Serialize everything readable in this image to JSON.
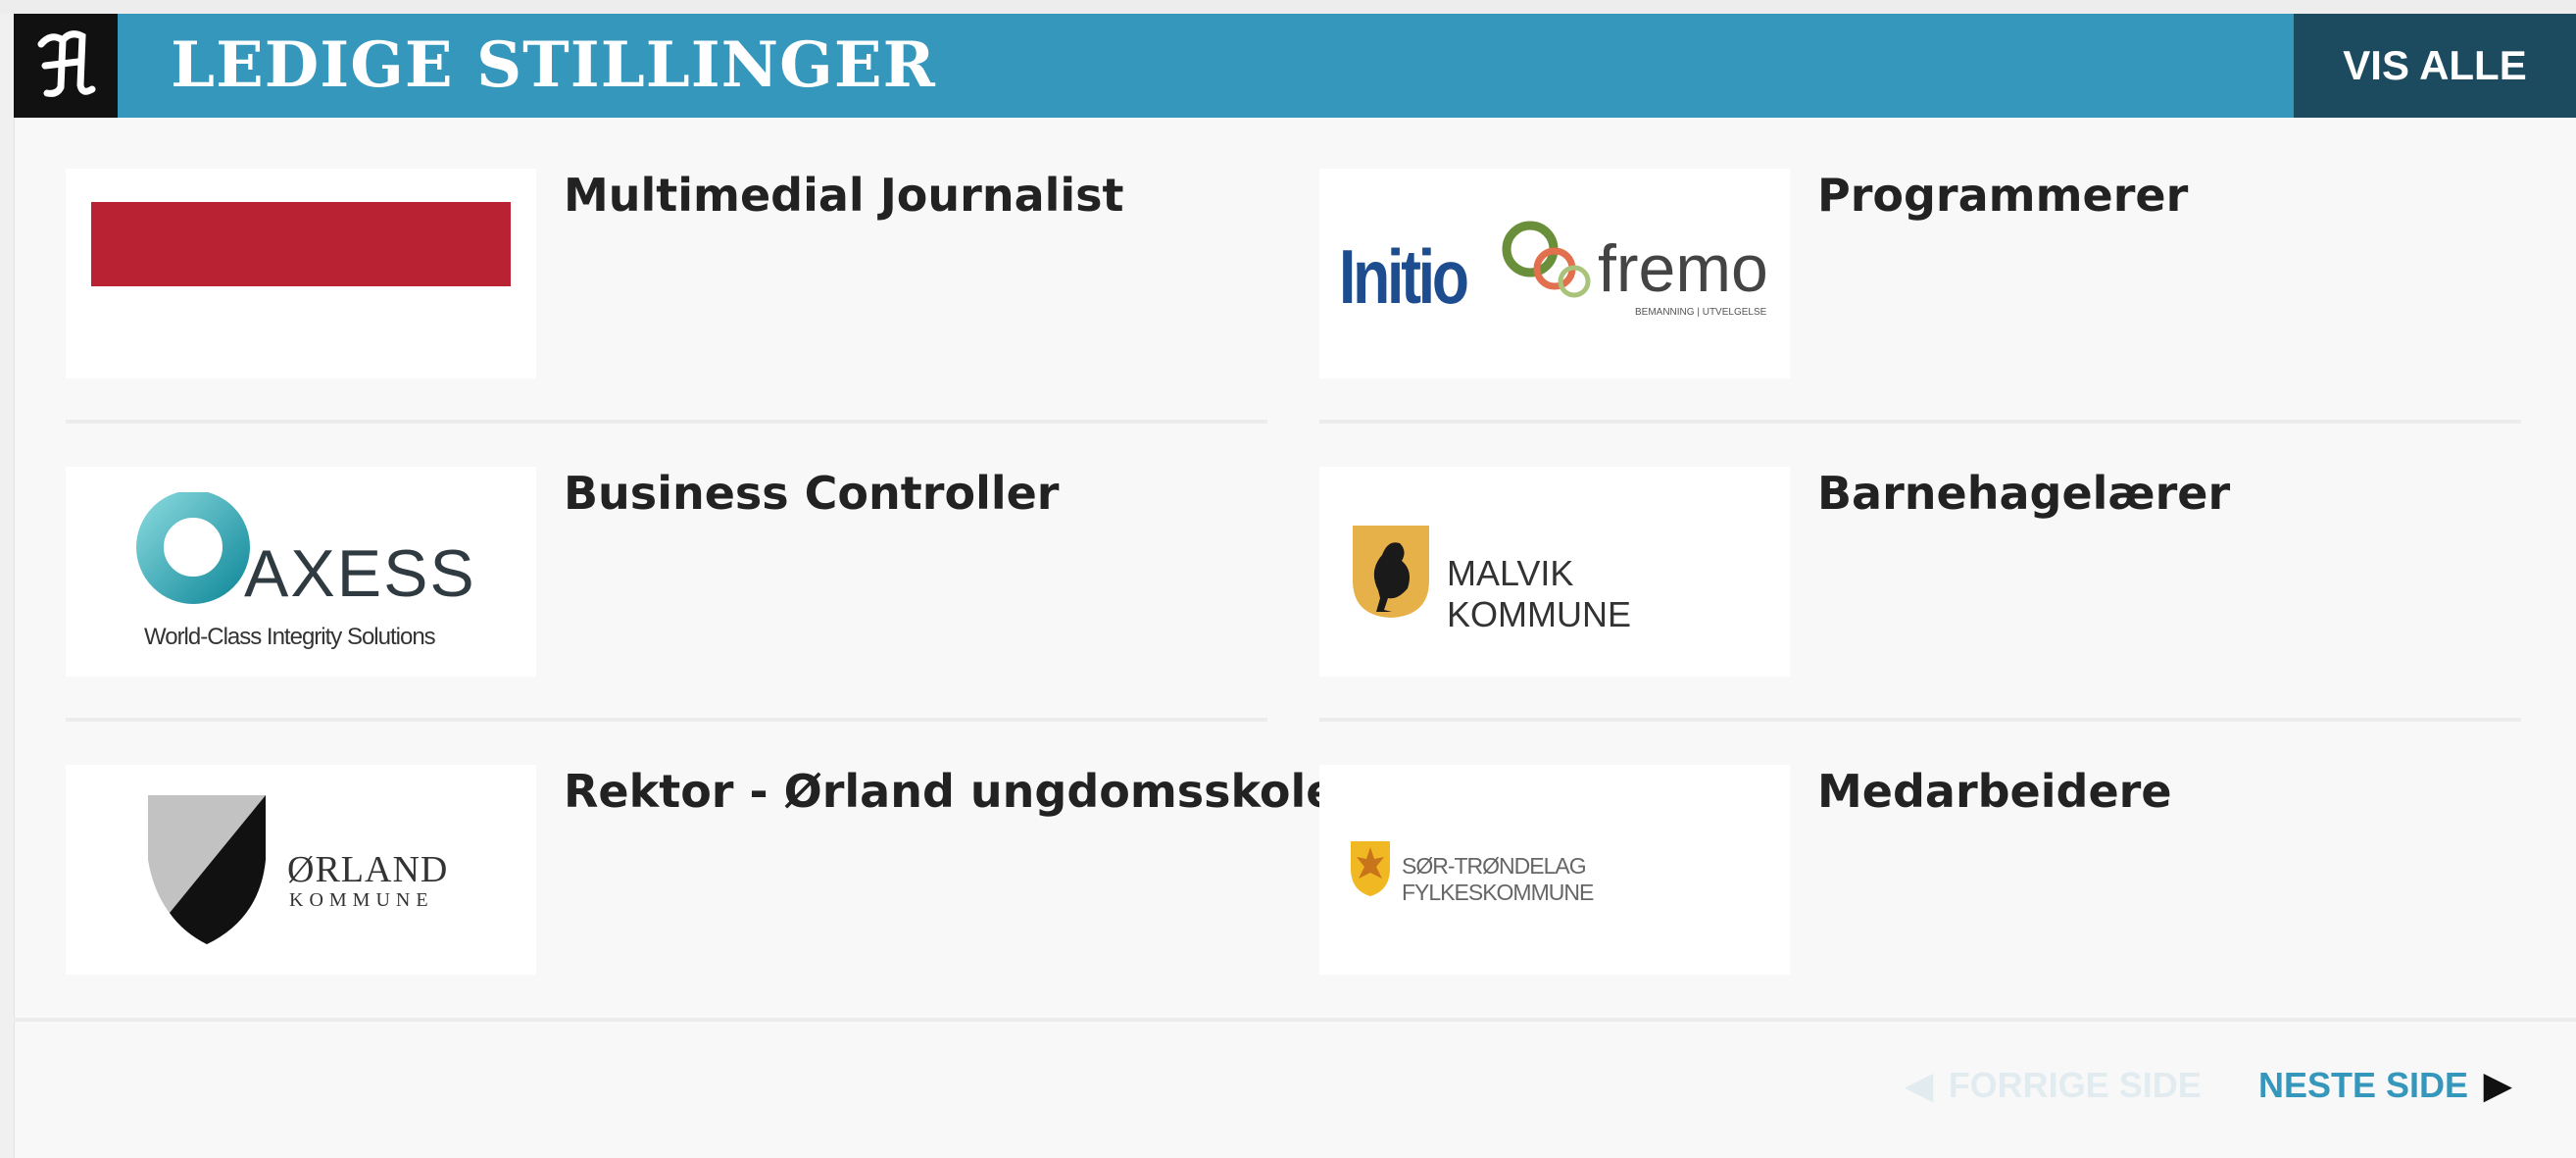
{
  "header": {
    "logo_glyph": "𝔄",
    "title": "LEDIGE STILLINGER",
    "vis_alle": "VIS ALLE"
  },
  "jobs": [
    {
      "title": "Multimedial Journalist",
      "logo": "red-bar-logo"
    },
    {
      "title": "Programmerer",
      "logo": "initio-fremo-logo",
      "logo_text_a": "Initio",
      "logo_text_b": "fremo",
      "logo_tagline": "BEMANNING | UTVELGELSE"
    },
    {
      "title": "Business Controller",
      "logo": "axess-logo",
      "logo_text_a": "AXESS",
      "logo_tagline": "World-Class Integrity Solutions"
    },
    {
      "title": "Barnehagelærer",
      "logo": "malvik-logo",
      "logo_text_a": "MALVIK KOMMUNE"
    },
    {
      "title": "Rektor - Ørland ungdomsskole",
      "logo": "orland-logo",
      "logo_text_a": "ØRLAND",
      "logo_tagline": "KOMMUNE"
    },
    {
      "title": "Medarbeidere",
      "logo": "sor-trondelag-logo",
      "logo_text_a": "SØR-TRØNDELAG FYLKESKOMMUNE"
    }
  ],
  "pager": {
    "prev_label": "FORRIGE SIDE",
    "next_label": "NESTE SIDE",
    "prev_arrow": "◀",
    "next_arrow": "▶"
  },
  "colors": {
    "header_bg": "#3597bb",
    "vis_alle_bg": "#1c4a5f",
    "red_bar": "#b82233",
    "next_link": "#3597bb"
  }
}
